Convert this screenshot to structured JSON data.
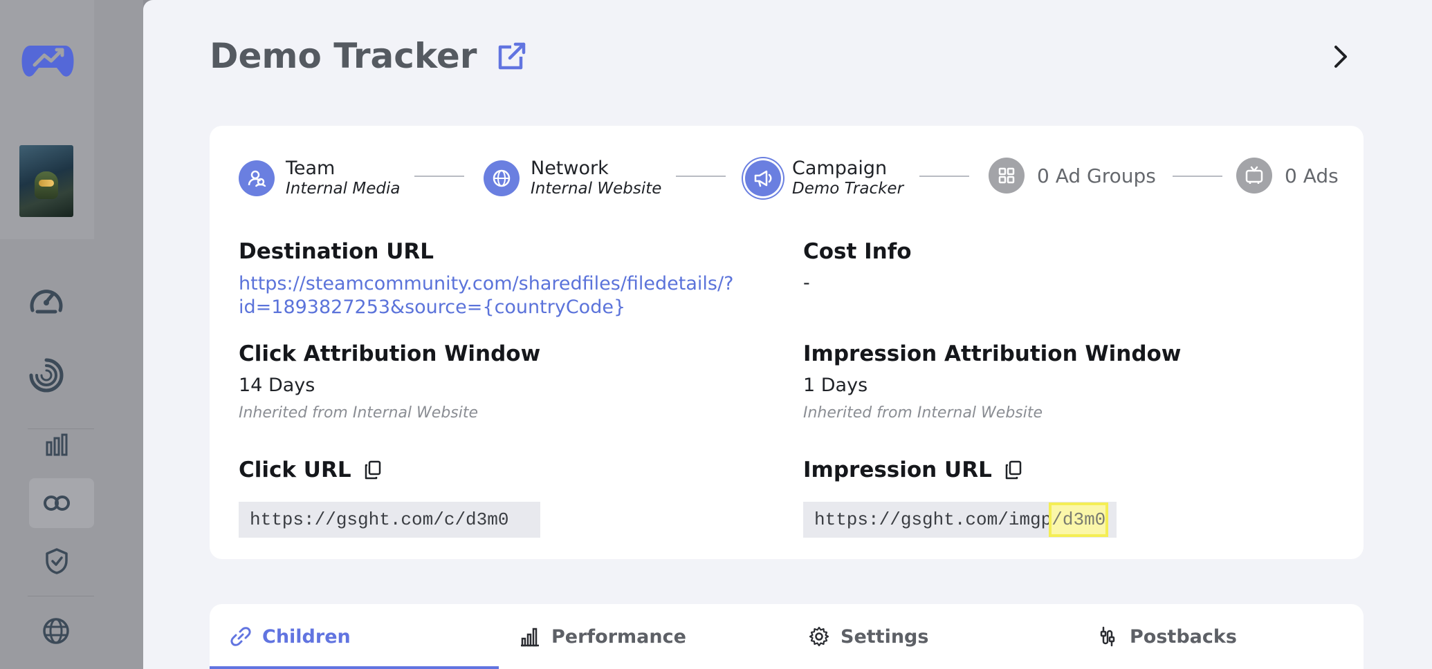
{
  "page": {
    "title": "Demo Tracker"
  },
  "stepper": {
    "team": {
      "label": "Team",
      "value": "Internal Media",
      "icon": "users-icon"
    },
    "network": {
      "label": "Network",
      "value": "Internal Website",
      "icon": "globe-icon"
    },
    "campaign": {
      "label": "Campaign",
      "value": "Demo Tracker",
      "icon": "megaphone-icon"
    },
    "ad_groups": {
      "label": "0 Ad Groups",
      "icon": "grid-icon"
    },
    "ads": {
      "label": "0 Ads",
      "icon": "tv-icon"
    }
  },
  "details": {
    "destination_url": {
      "heading": "Destination URL",
      "value_line1": "https://steamcommunity.com/sharedfiles/filedetails/?",
      "value_line2": "id=1893827253&source={countryCode}"
    },
    "cost_info": {
      "heading": "Cost Info",
      "value": "-"
    },
    "click_attribution": {
      "heading": "Click Attribution Window",
      "value": "14 Days",
      "note": "Inherited from Internal Website"
    },
    "impression_attribution": {
      "heading": "Impression Attribution Window",
      "value": "1 Days",
      "note": "Inherited from Internal Website"
    },
    "click_url": {
      "heading": "Click URL",
      "value": "https://gsght.com/c/d3m0"
    },
    "impression_url": {
      "heading": "Impression URL",
      "value_prefix": "https://gsght.com/imgp",
      "value_highlight": "/d3m0"
    }
  },
  "tabs": [
    {
      "label": "Children",
      "icon": "link-icon",
      "active": true
    },
    {
      "label": "Performance",
      "icon": "bar-chart-icon",
      "active": false
    },
    {
      "label": "Settings",
      "icon": "gear-icon",
      "active": false
    },
    {
      "label": "Postbacks",
      "icon": "cable-icon",
      "active": false
    }
  ],
  "colors": {
    "accent": "#6174e0",
    "highlight": "#f4ee55",
    "text": "#15171b",
    "muted": "#8a8d93"
  }
}
